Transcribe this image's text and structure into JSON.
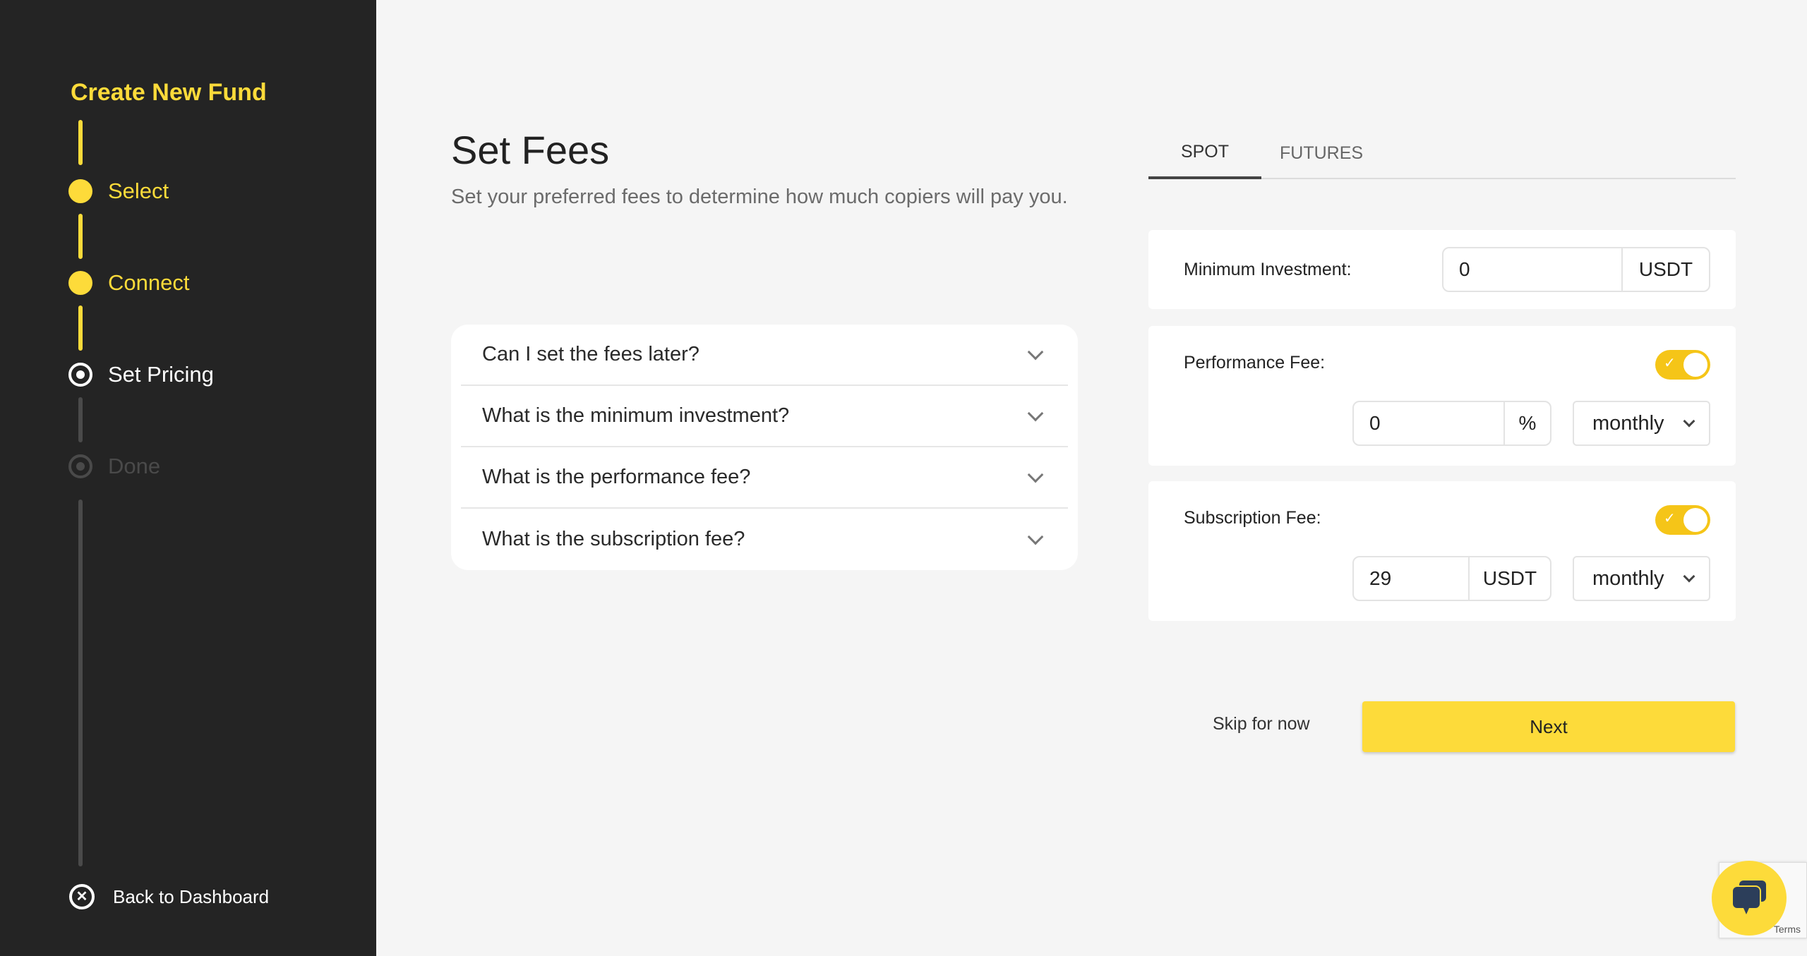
{
  "sidebar": {
    "title": "Create New Fund",
    "steps": [
      {
        "label": "Select",
        "state": "completed"
      },
      {
        "label": "Connect",
        "state": "completed"
      },
      {
        "label": "Set Pricing",
        "state": "active"
      },
      {
        "label": "Done",
        "state": "pending"
      }
    ],
    "back_label": "Back to Dashboard",
    "back_icon": "close-circle-icon"
  },
  "main": {
    "title": "Set Fees",
    "subtitle": "Set your preferred fees to determine how much copiers will pay you.",
    "faq": [
      {
        "question": "Can I set the fees later?"
      },
      {
        "question": "What is the minimum investment?"
      },
      {
        "question": "What is the performance fee?"
      },
      {
        "question": "What is the subscription fee?"
      }
    ]
  },
  "tabs": [
    {
      "label": "SPOT",
      "active": true
    },
    {
      "label": "FUTURES",
      "active": false
    }
  ],
  "form": {
    "minimum_investment": {
      "label": "Minimum Investment:",
      "value": "0",
      "unit": "USDT"
    },
    "performance_fee": {
      "label": "Performance Fee:",
      "enabled": true,
      "value": "0",
      "unit": "%",
      "period": "monthly"
    },
    "subscription_fee": {
      "label": "Subscription Fee:",
      "enabled": true,
      "value": "29",
      "unit": "USDT",
      "period": "monthly"
    }
  },
  "actions": {
    "skip_label": "Skip for now",
    "next_label": "Next"
  },
  "widgets": {
    "recaptcha_text": "Terms",
    "chat_icon": "chat-bubbles-icon"
  },
  "colors": {
    "accent": "#fddb3a",
    "sidebar_bg": "#242424",
    "page_bg": "#f5f5f5"
  }
}
